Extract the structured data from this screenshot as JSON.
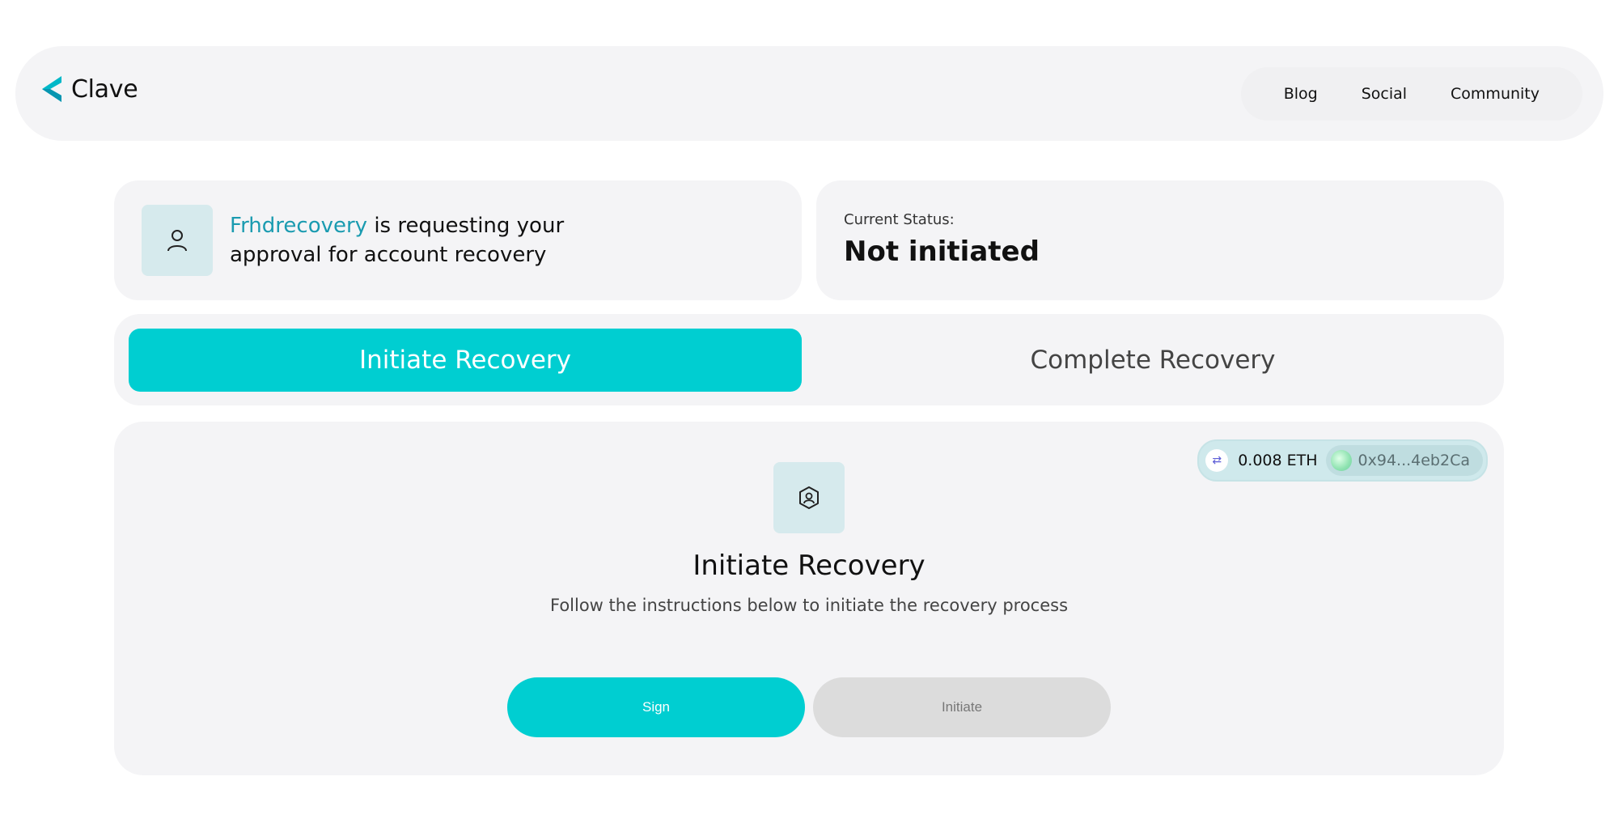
{
  "header": {
    "brand": "Clave",
    "nav": [
      "Blog",
      "Social",
      "Community"
    ]
  },
  "request": {
    "name": "Frhdrecovery",
    "message": " is requesting your approval for account recovery"
  },
  "status": {
    "label": "Current Status:",
    "value": "Not initiated"
  },
  "tabs": {
    "initiate": "Initiate Recovery",
    "complete": "Complete Recovery"
  },
  "wallet": {
    "balance": "0.008 ETH",
    "address": "0x94...4eb2Ca"
  },
  "panel": {
    "title": "Initiate Recovery",
    "description": "Follow the instructions below to initiate the recovery process",
    "sign_label": "Sign",
    "initiate_label": "Initiate"
  },
  "colors": {
    "accent": "#00ced1",
    "link": "#1a9bb0",
    "panel": "#f4f4f6",
    "icon_bg": "#d6eaed",
    "disabled": "#dcdcdc"
  }
}
